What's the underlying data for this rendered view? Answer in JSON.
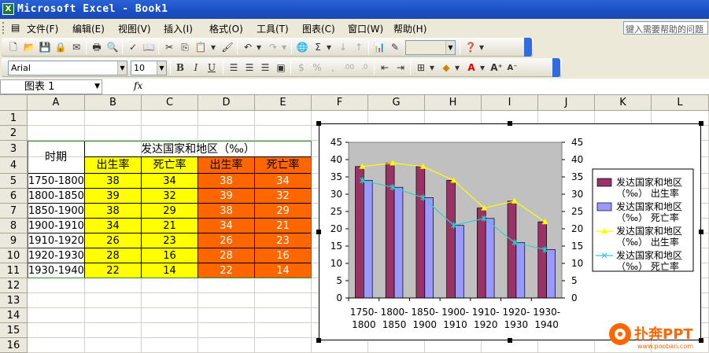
{
  "titlebar": {
    "app_icon": "excel-icon",
    "title": "Microsoft Excel - Book1"
  },
  "menu": [
    "文件(F)",
    "编辑(E)",
    "视图(V)",
    "插入(I)",
    "格式(O)",
    "工具(T)",
    "图表(C)",
    "窗口(W)",
    "帮助(H)"
  ],
  "help_placeholder": "键入需要帮助的问题",
  "format_toolbar": {
    "font": "Arial",
    "size": "10"
  },
  "formula_bar": {
    "name_box": "图表 1",
    "fx": "fx"
  },
  "columns": [
    "A",
    "B",
    "C",
    "D",
    "E",
    "F",
    "G",
    "H",
    "I",
    "J",
    "K",
    "L"
  ],
  "rows": [
    "1",
    "2",
    "3",
    "4",
    "5",
    "6",
    "7",
    "8",
    "9",
    "10",
    "11",
    "12",
    "13",
    "14",
    "15",
    "16"
  ],
  "table": {
    "period_header": "时期",
    "group_header": "发达国家和地区（‰）",
    "sub_headers": [
      "出生率",
      "死亡率",
      "出生率",
      "死亡率"
    ],
    "periods": [
      "1750-1800",
      "1800-1850",
      "1850-1900",
      "1900-1910",
      "1910-1920",
      "1920-1930",
      "1930-1940"
    ],
    "birth": [
      38,
      39,
      38,
      34,
      26,
      28,
      22
    ],
    "death": [
      34,
      32,
      29,
      21,
      23,
      16,
      14
    ]
  },
  "chart_data": {
    "type": "bar",
    "categories": [
      "1750-1800",
      "1800-1850",
      "1850-1900",
      "1900-1910",
      "1910-1920",
      "1920-1930",
      "1930-1940"
    ],
    "category_lines": [
      [
        "1750-",
        "1800"
      ],
      [
        "1800-",
        "1850"
      ],
      [
        "1850-",
        "1900"
      ],
      [
        "1900-",
        "1910"
      ],
      [
        "1910-",
        "1920"
      ],
      [
        "1920-",
        "1930"
      ],
      [
        "1930-",
        "1940"
      ]
    ],
    "ylim": [
      0,
      45
    ],
    "yticks": [
      0,
      5,
      10,
      15,
      20,
      25,
      30,
      35,
      40,
      45
    ],
    "plot_background": "#c0c0c0",
    "legend_position": "right",
    "series": [
      {
        "name": "发达国家和地区（‰） 出生率",
        "legend_lines": [
          "发达国家和地区",
          "（‰） 出生率"
        ],
        "kind": "bar",
        "color": "#993366",
        "values": [
          38,
          39,
          38,
          34,
          26,
          28,
          22
        ]
      },
      {
        "name": "发达国家和地区（‰） 死亡率",
        "legend_lines": [
          "发达国家和地区",
          "（‰） 死亡率"
        ],
        "kind": "bar",
        "color": "#9999ff",
        "values": [
          34,
          32,
          29,
          21,
          23,
          16,
          14
        ]
      },
      {
        "name": "发达国家和地区（‰） 出生率",
        "legend_lines": [
          "发达国家和地区",
          "（‰） 出生率"
        ],
        "kind": "line",
        "color": "#ffff00",
        "marker": "triangle",
        "values": [
          38,
          39,
          38,
          34,
          26,
          28,
          22
        ]
      },
      {
        "name": "发达国家和地区（‰） 死亡率",
        "legend_lines": [
          "发达国家和地区",
          "（‰） 死亡率"
        ],
        "kind": "line",
        "color": "#33cccc",
        "marker": "x",
        "values": [
          34,
          32,
          29,
          21,
          23,
          16,
          14
        ]
      }
    ]
  },
  "watermark": {
    "brand": "扑奔PPT",
    "url": "www.pooban.com"
  }
}
